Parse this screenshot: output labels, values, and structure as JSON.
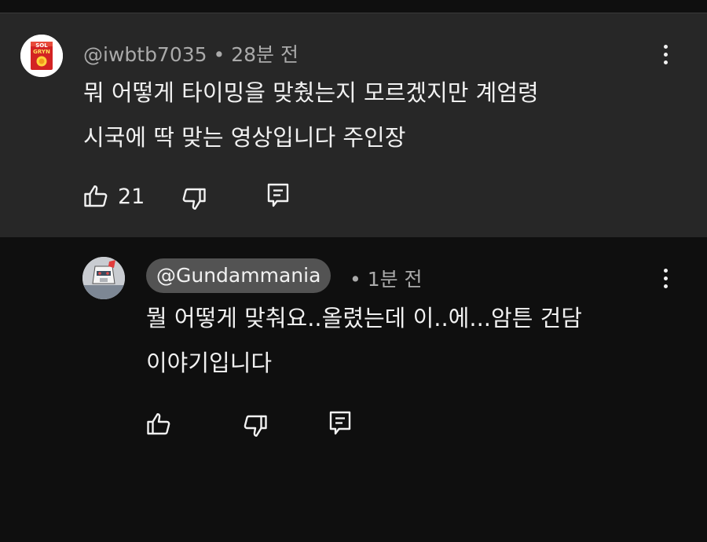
{
  "comments": [
    {
      "handle": "@iwbtb7035",
      "time_sep": " • ",
      "time": "28분 전",
      "lines": [
        "뭐 어떻게 타이밍을 맞췄는지 모르겠지만 계엄령",
        "시국에 딱 맞는 영상입니다 주인장"
      ],
      "like_count": "21",
      "avatar_icon": "sol-gryn-box-icon"
    },
    {
      "handle": "@Gundammania",
      "time_sep": " • ",
      "time": "1분 전",
      "lines": [
        "뭘 어떻게 맞춰요..올렸는데 이..에...암튼 건담",
        "이야기입니다"
      ],
      "like_count": "",
      "avatar_icon": "gundam-head-icon"
    }
  ],
  "avatar_text": {
    "brand_top": "SOL",
    "brand_bottom": "GRYN"
  },
  "colors": {
    "page_bg": "#0f0f0f",
    "highlight_bg": "#272727",
    "chip_bg": "#535353",
    "text": "#f1f1f1",
    "meta": "#aaaaaa"
  }
}
